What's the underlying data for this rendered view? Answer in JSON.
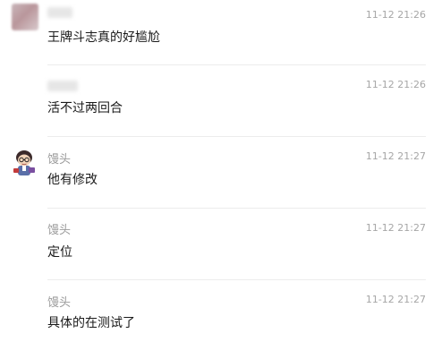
{
  "messages": [
    {
      "sender": "",
      "time": "11-12 21:26",
      "text": "王牌斗志真的好尴尬"
    },
    {
      "sender": "",
      "time": "11-12 21:26",
      "text": "活不过两回合"
    },
    {
      "sender": "馒头",
      "time": "11-12 21:27",
      "text": "他有修改"
    },
    {
      "sender": "馒头",
      "time": "11-12 21:27",
      "text": "定位"
    },
    {
      "sender": "馒头",
      "time": "11-12 21:27",
      "text": "具体的在测试了"
    }
  ]
}
